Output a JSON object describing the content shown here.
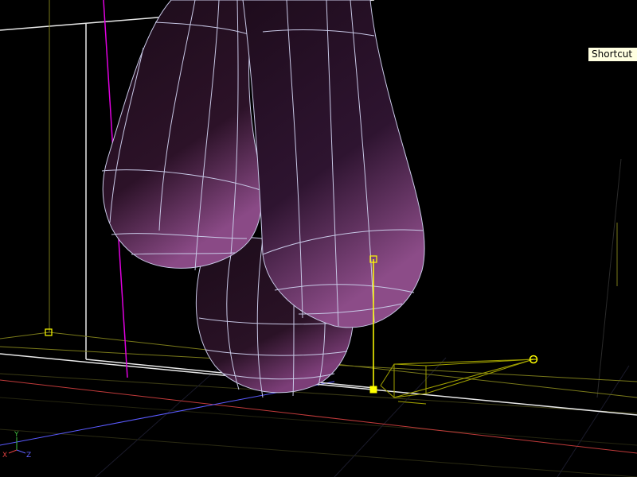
{
  "viewport": {
    "tooltip": {
      "text": "Shortcut"
    },
    "axis_gizmo": {
      "y_label": "Y",
      "x_label": "X",
      "z_label": "Z"
    },
    "colors": {
      "background": "#000000",
      "mesh_fill": "#2a1226",
      "mesh_highlight": "#8a4a86",
      "wireframe": "#c8c8e6",
      "selection": "#ffff00",
      "bounding_box": "#ffffff",
      "camera_frustum": "#a0a000",
      "grid_line": "#3a3a14",
      "axis_x": "#e04040",
      "axis_y": "#40c040",
      "axis_z": "#6060ff",
      "magenta_guide": "#e000e0",
      "tooltip_bg": "#ffffe1"
    }
  }
}
